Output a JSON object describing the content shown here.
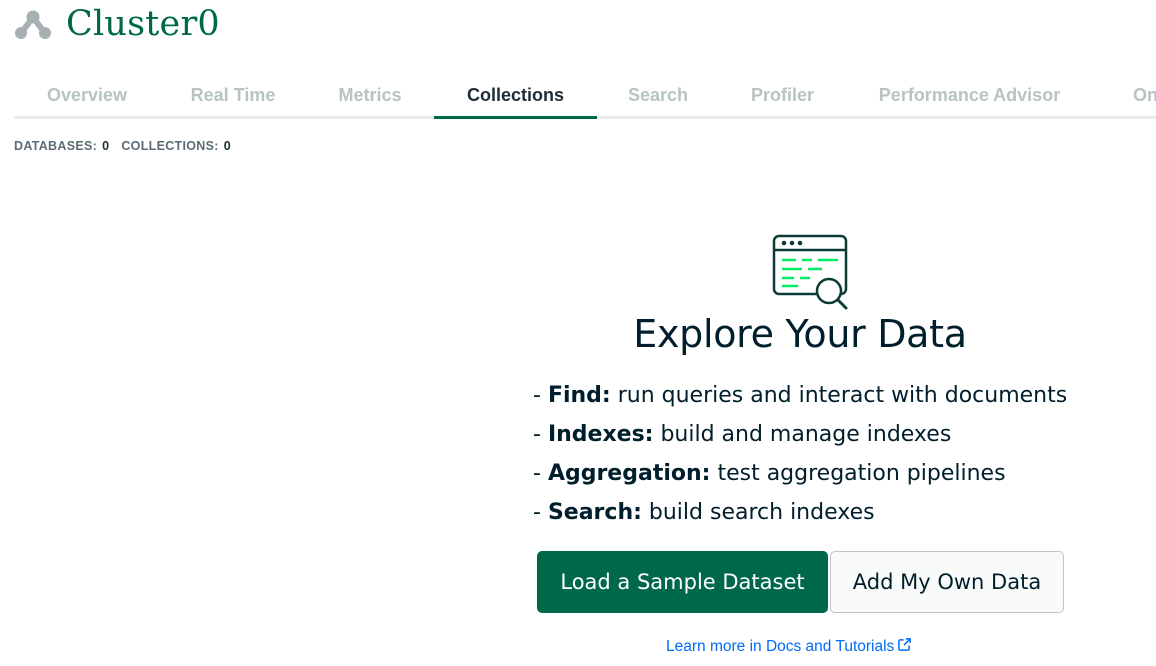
{
  "cluster": {
    "name": "Cluster0",
    "icon": "cluster-nodes-icon"
  },
  "tabs": [
    {
      "label": "Overview",
      "active": false
    },
    {
      "label": "Real Time",
      "active": false
    },
    {
      "label": "Metrics",
      "active": false
    },
    {
      "label": "Collections",
      "active": true
    },
    {
      "label": "Search",
      "active": false
    },
    {
      "label": "Profiler",
      "active": false
    },
    {
      "label": "Performance Advisor",
      "active": false
    },
    {
      "label": "Onl",
      "active": false
    }
  ],
  "stats": {
    "databases_label": "DATABASES:",
    "databases_value": "0",
    "collections_label": "COLLECTIONS:",
    "collections_value": "0"
  },
  "empty_state": {
    "icon": "browser-search-icon",
    "title": "Explore Your Data",
    "features": [
      {
        "prefix": "- ",
        "term": "Find:",
        "desc": " run queries and interact with documents"
      },
      {
        "prefix": "- ",
        "term": "Indexes:",
        "desc": " build and manage indexes"
      },
      {
        "prefix": "- ",
        "term": "Aggregation:",
        "desc": " test aggregation pipelines"
      },
      {
        "prefix": "- ",
        "term": "Search:",
        "desc": " build search indexes"
      }
    ],
    "primary_button": "Load a Sample Dataset",
    "secondary_button": "Add My Own Data",
    "learn_link": "Learn more in Docs and Tutorials",
    "learn_link_icon": "external-link-icon"
  },
  "colors": {
    "brand_green": "#00684a",
    "link_blue": "#016bf8",
    "inactive_tab": "#b8c4c2"
  }
}
